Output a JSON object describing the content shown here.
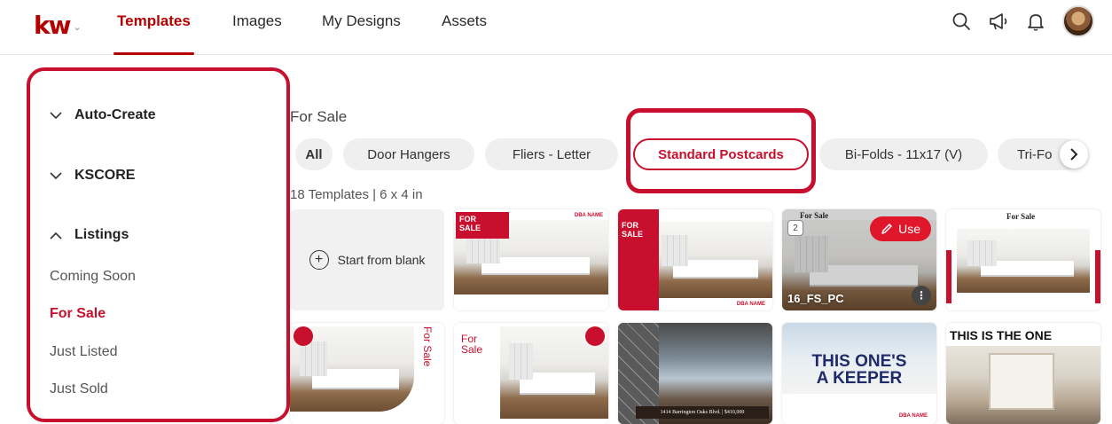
{
  "nav": {
    "logo": "kw",
    "tabs": [
      {
        "label": "Templates",
        "active": true
      },
      {
        "label": "Images",
        "active": false
      },
      {
        "label": "My Designs",
        "active": false
      },
      {
        "label": "Assets",
        "active": false
      }
    ],
    "icons": [
      "search-icon",
      "megaphone-icon",
      "bell-icon",
      "avatar"
    ],
    "accent_color": "#b40101"
  },
  "sidebar": {
    "groups": [
      {
        "label": "Auto-Create",
        "expanded": false
      },
      {
        "label": "KSCORE",
        "expanded": false
      },
      {
        "label": "Listings",
        "expanded": true
      }
    ],
    "items": [
      {
        "label": "Coming Soon",
        "active": false
      },
      {
        "label": "For Sale",
        "active": true
      },
      {
        "label": "Just Listed",
        "active": false
      },
      {
        "label": "Just Sold",
        "active": false
      }
    ]
  },
  "main": {
    "section_title": "For Sale",
    "chips": [
      {
        "label": "All",
        "active": false
      },
      {
        "label": "Door Hangers",
        "active": false
      },
      {
        "label": "Fliers - Letter",
        "active": false
      },
      {
        "label": "Standard Postcards",
        "active": true
      },
      {
        "label": "Bi-Folds - 11x17 (V)",
        "active": false
      },
      {
        "label": "Tri-Fo",
        "active": false
      }
    ],
    "count_text": "18 Templates | 6 x 4 in",
    "blank_card_label": "Start from blank",
    "hover_card": {
      "use_label": "Use",
      "name": "16_FS_PC",
      "page_count": "2",
      "title": "For Sale"
    },
    "card_texts": {
      "for_sale_stack": "FOR\nSALE",
      "for_sale_serif": "For Sale",
      "for_sale_vertical": "For Sale",
      "for_sale_two_line": "For\nSale",
      "keeper": "THIS ONE'S\nA KEEPER",
      "this_is_the_one": "THIS IS THE ONE",
      "address_line": "1414 Barrington Oaks Blvd. | $410,000",
      "agent_label": "DBA NAME"
    },
    "highlight_color": "#c8102e"
  }
}
